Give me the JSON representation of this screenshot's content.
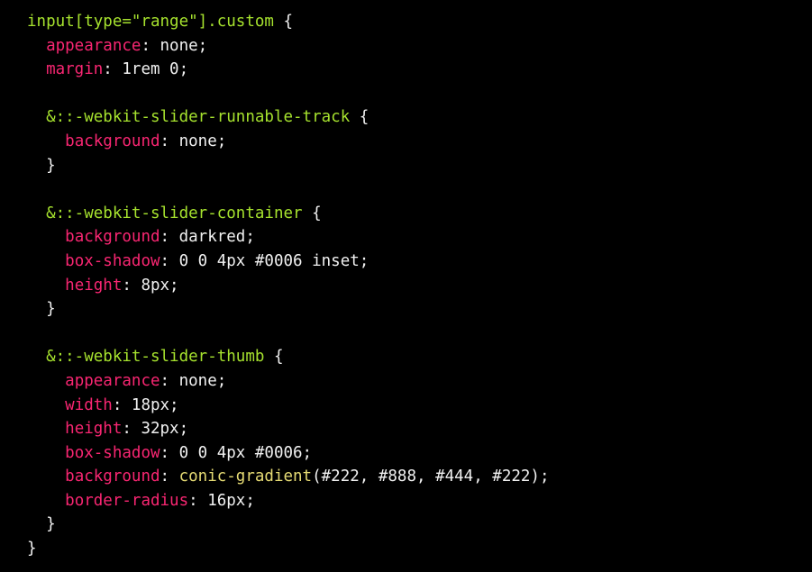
{
  "colors": {
    "background": "#000000",
    "selector": "#a6e22e",
    "property": "#f92672",
    "value": "#f1f1f1",
    "function": "#e6db74"
  },
  "code_lines": [
    [
      {
        "t": "input[type=\"range\"].custom",
        "k": "selector"
      },
      {
        "t": " {",
        "k": "punct"
      }
    ],
    [
      {
        "t": "  ",
        "k": "punct"
      },
      {
        "t": "appearance",
        "k": "property"
      },
      {
        "t": ": none;",
        "k": "value"
      }
    ],
    [
      {
        "t": "  ",
        "k": "punct"
      },
      {
        "t": "margin",
        "k": "property"
      },
      {
        "t": ": 1rem 0;",
        "k": "value"
      }
    ],
    [],
    [
      {
        "t": "  ",
        "k": "punct"
      },
      {
        "t": "&::-webkit-slider-runnable-track",
        "k": "selector"
      },
      {
        "t": " {",
        "k": "punct"
      }
    ],
    [
      {
        "t": "    ",
        "k": "punct"
      },
      {
        "t": "background",
        "k": "property"
      },
      {
        "t": ": none;",
        "k": "value"
      }
    ],
    [
      {
        "t": "  }",
        "k": "punct"
      }
    ],
    [],
    [
      {
        "t": "  ",
        "k": "punct"
      },
      {
        "t": "&::-webkit-slider-container",
        "k": "selector"
      },
      {
        "t": " {",
        "k": "punct"
      }
    ],
    [
      {
        "t": "    ",
        "k": "punct"
      },
      {
        "t": "background",
        "k": "property"
      },
      {
        "t": ": darkred;",
        "k": "value"
      }
    ],
    [
      {
        "t": "    ",
        "k": "punct"
      },
      {
        "t": "box-shadow",
        "k": "property"
      },
      {
        "t": ": 0 0 4px #0006 inset;",
        "k": "value"
      }
    ],
    [
      {
        "t": "    ",
        "k": "punct"
      },
      {
        "t": "height",
        "k": "property"
      },
      {
        "t": ": 8px;",
        "k": "value"
      }
    ],
    [
      {
        "t": "  }",
        "k": "punct"
      }
    ],
    [],
    [
      {
        "t": "  ",
        "k": "punct"
      },
      {
        "t": "&::-webkit-slider-thumb",
        "k": "selector"
      },
      {
        "t": " {",
        "k": "punct"
      }
    ],
    [
      {
        "t": "    ",
        "k": "punct"
      },
      {
        "t": "appearance",
        "k": "property"
      },
      {
        "t": ": none;",
        "k": "value"
      }
    ],
    [
      {
        "t": "    ",
        "k": "punct"
      },
      {
        "t": "width",
        "k": "property"
      },
      {
        "t": ": 18px;",
        "k": "value"
      }
    ],
    [
      {
        "t": "    ",
        "k": "punct"
      },
      {
        "t": "height",
        "k": "property"
      },
      {
        "t": ": 32px;",
        "k": "value"
      }
    ],
    [
      {
        "t": "    ",
        "k": "punct"
      },
      {
        "t": "box-shadow",
        "k": "property"
      },
      {
        "t": ": 0 0 4px #0006;",
        "k": "value"
      }
    ],
    [
      {
        "t": "    ",
        "k": "punct"
      },
      {
        "t": "background",
        "k": "property"
      },
      {
        "t": ": ",
        "k": "value"
      },
      {
        "t": "conic-gradient",
        "k": "func"
      },
      {
        "t": "(#222, #888, #444, #222);",
        "k": "value"
      }
    ],
    [
      {
        "t": "    ",
        "k": "punct"
      },
      {
        "t": "border-radius",
        "k": "property"
      },
      {
        "t": ": 16px;",
        "k": "value"
      }
    ],
    [
      {
        "t": "  }",
        "k": "punct"
      }
    ],
    [
      {
        "t": "}",
        "k": "punct"
      }
    ]
  ]
}
